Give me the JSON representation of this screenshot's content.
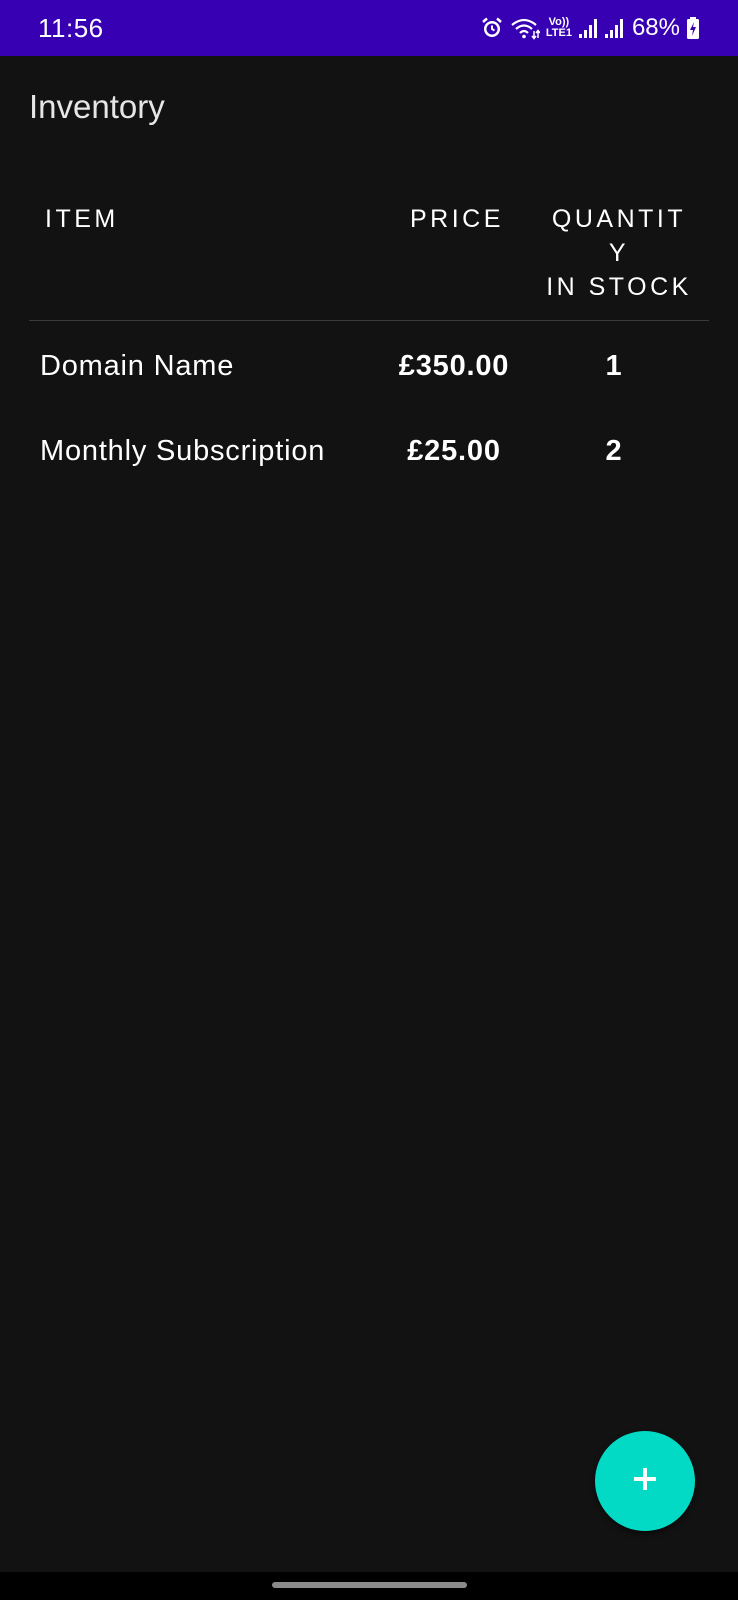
{
  "status_bar": {
    "time": "11:56",
    "lte_top": "Vo))",
    "lte_bottom": "LTE1",
    "battery": "68%",
    "icons": [
      "alarm-icon",
      "wifi-icon",
      "signal-icon",
      "signal-icon",
      "battery-charging-icon"
    ],
    "background": "#3700b3"
  },
  "app": {
    "title": "Inventory"
  },
  "table": {
    "headers": {
      "item": "ITEM",
      "price": "PRICE",
      "quantity": "QUANTIT\nY\nIN STOCK"
    },
    "rows": [
      {
        "item": "Domain Name",
        "price": "£350.00",
        "quantity": "1"
      },
      {
        "item": "Monthly Subscription",
        "price": "£25.00",
        "quantity": "2"
      }
    ]
  },
  "fab": {
    "icon": "plus-icon",
    "color": "#03dac5"
  },
  "theme": {
    "background": "#121212",
    "text": "#ffffff"
  }
}
